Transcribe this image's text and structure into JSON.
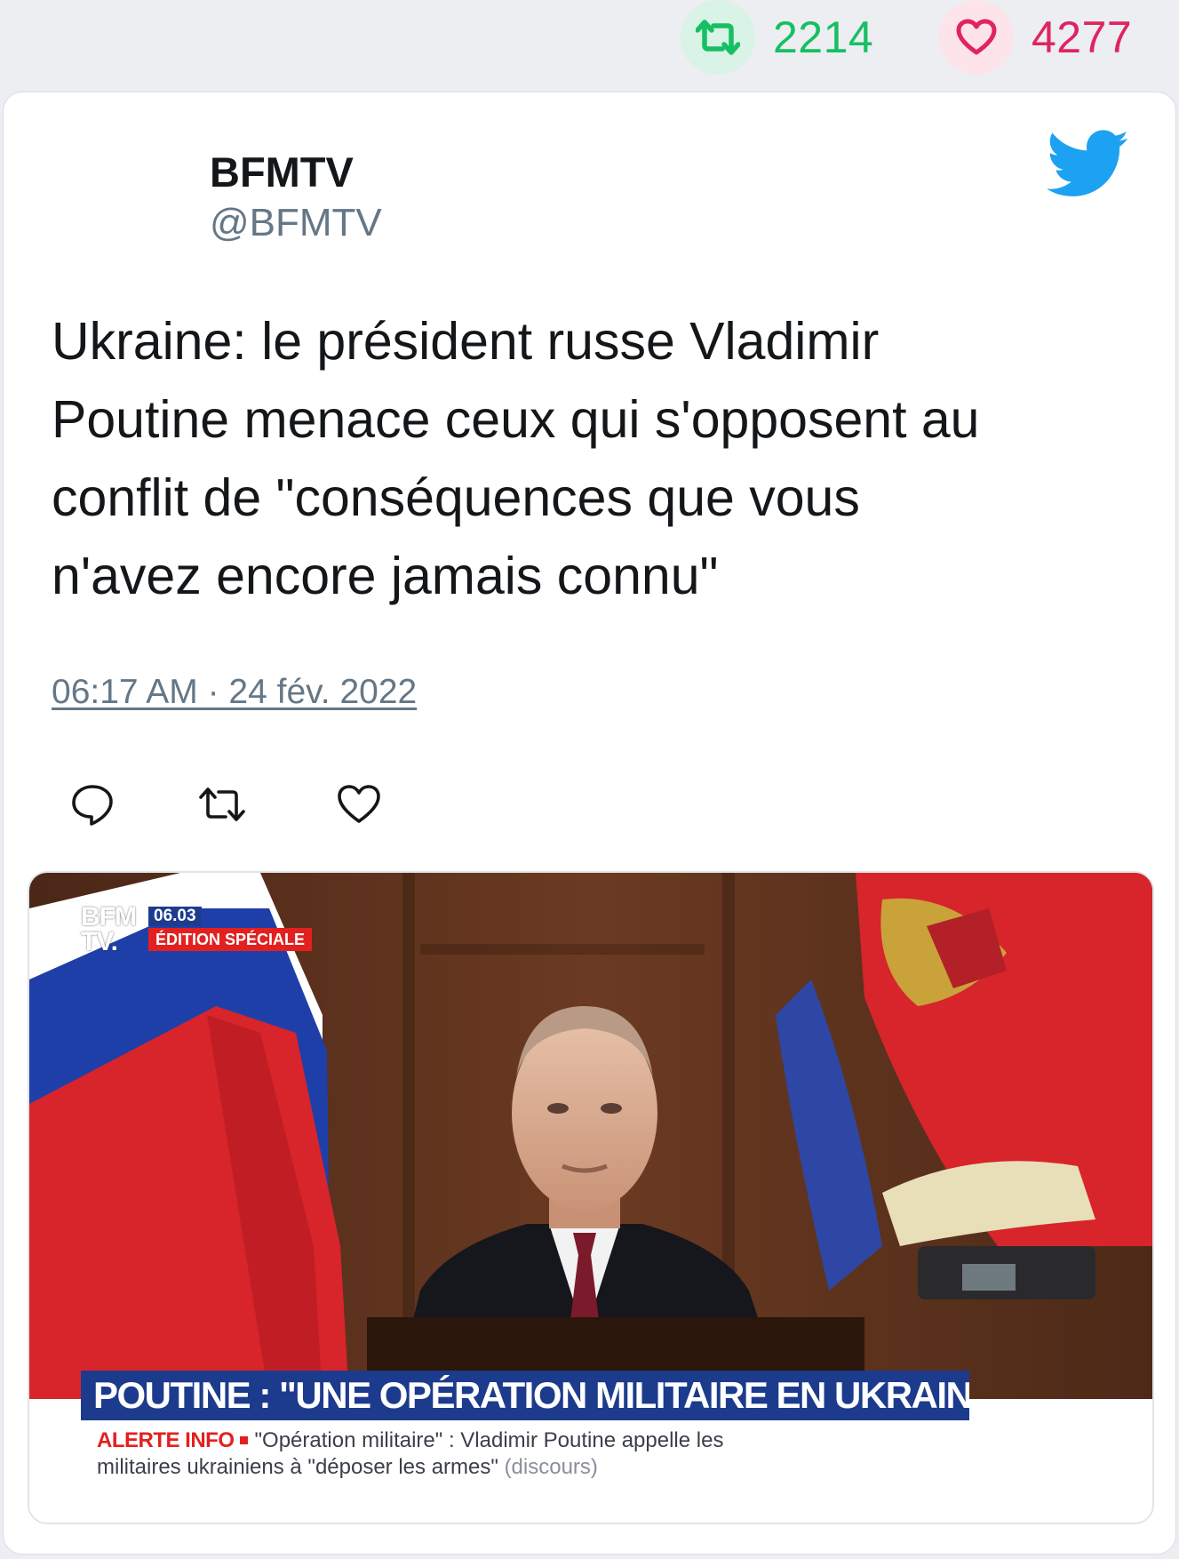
{
  "stats": {
    "retweets": "2214",
    "likes": "4277",
    "retweet_color": "#17bf63",
    "like_color": "#e0245e"
  },
  "tweet": {
    "author_name": "BFMTV",
    "author_handle": "@BFMTV",
    "text_lines": [
      "Ukraine: le président russe Vladimir",
      "Poutine menace ceux qui s'opposent au",
      "conflit de \"conséquences que vous",
      "n'avez encore jamais connu\""
    ],
    "timestamp": "06:17 AM · 24 fév. 2022",
    "actions": [
      "reply-icon",
      "retweet-icon",
      "like-icon"
    ],
    "brand_icon": "twitter-bird-icon",
    "brand_color": "#1da1f2"
  },
  "media": {
    "channel_logo_line1": "BFM",
    "channel_logo_line2": "TV.",
    "time_badge": "06.03",
    "edition_badge": "ÉDITION SPÉCIALE",
    "headline": "POUTINE : \"UNE OPÉRATION MILITAIRE EN UKRAINE\"",
    "ticker_label": "ALERTE INFO",
    "ticker_text_line1": "\"Opération militaire\" : Vladimir Poutine appelle les",
    "ticker_text_line2": "militaires ukrainiens à \"déposer les armes\"",
    "ticker_tag": "(discours)"
  }
}
